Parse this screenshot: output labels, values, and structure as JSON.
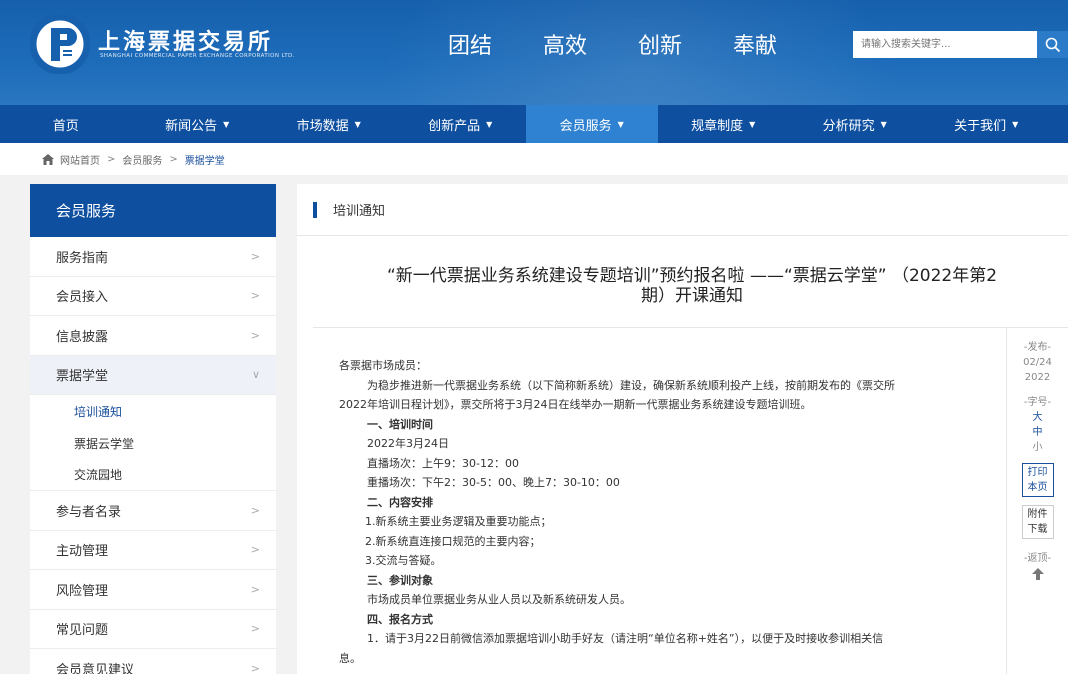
{
  "header": {
    "logo_text": "上海票据交易所",
    "logo_sub": "SHANGHAI COMMERCIAL PAPER EXCHANGE CORPORATION LTD.",
    "slogans": [
      "团结",
      "高效",
      "创新",
      "奉献"
    ],
    "search_placeholder": "请输入搜索关键字...",
    "colors": {
      "primary": "#0e4fa0",
      "accent": "#2f82d2"
    }
  },
  "nav": {
    "items": [
      {
        "label": "首页",
        "caret": ""
      },
      {
        "label": "新闻公告",
        "caret": "▼"
      },
      {
        "label": "市场数据",
        "caret": "▼"
      },
      {
        "label": "创新产品",
        "caret": "▼"
      },
      {
        "label": "会员服务",
        "caret": "▼"
      },
      {
        "label": "规章制度",
        "caret": "▼"
      },
      {
        "label": "分析研究",
        "caret": "▼"
      },
      {
        "label": "关于我们",
        "caret": "▼"
      }
    ],
    "active_index": 4
  },
  "breadcrumb": {
    "items": [
      "网站首页",
      "会员服务",
      "票据学堂"
    ],
    "separator": ">"
  },
  "sidebar": {
    "title": "会员服务",
    "items_top": [
      {
        "label": "服务指南",
        "arrow": ">"
      },
      {
        "label": "会员接入",
        "arrow": ">"
      },
      {
        "label": "信息披露",
        "arrow": ">"
      },
      {
        "label": "票据学堂",
        "arrow": "∨"
      }
    ],
    "subitems": [
      "培训通知",
      "票据云学堂",
      "交流园地"
    ],
    "items_bottom": [
      {
        "label": "参与者名录",
        "arrow": ">"
      },
      {
        "label": "主动管理",
        "arrow": ">"
      },
      {
        "label": "风险管理",
        "arrow": ">"
      },
      {
        "label": "常见问题",
        "arrow": ">"
      },
      {
        "label": "会员意见建议",
        "arrow": ">"
      }
    ]
  },
  "content": {
    "section_title": "培训通知",
    "article_title_1": "“新一代票据业务系统建设专题培训”预约报名啦 ——“票据云学堂” （2022年第2",
    "article_title_2": "期）开课通知",
    "body": {
      "greeting": "各票据市场成员：",
      "intro_1": "为稳步推进新一代票据业务系统（以下简称新系统）建设，确保新系统顺利投产上线，按前期发布的《票交所",
      "intro_2": "2022年培训日程计划》，票交所将于3月24日在线举办一期新一代票据业务系统建设专题培训班。",
      "h1": "一、培训时间",
      "date": "2022年3月24日",
      "live": "直播场次：上午9：30-12：00",
      "replay": "重播场次：下午2：30-5：00、晚上7：30-10：00",
      "h2": "二、内容安排",
      "c1": "1.新系统主要业务逻辑及重要功能点；",
      "c2": "2.新系统直连接口规范的主要内容；",
      "c3": "3.交流与答疑。",
      "h3": "三、参训对象",
      "audience": "市场成员单位票据业务从业人员以及新系统研发人员。",
      "h4": "四、报名方式",
      "signup_1": "1．请于3月22日前微信添加票据培训小助手好友（请注明“单位名称+姓名”），以便于及时接收参训相关信",
      "signup_2": "息。"
    }
  },
  "tools": {
    "publish_label": "-发布-",
    "publish_date_1": "02/24",
    "publish_date_2": "2022",
    "fontsize_label": "-字号-",
    "size_large": "大",
    "size_medium": "中",
    "size_small": "小",
    "print_1": "打印",
    "print_2": "本页",
    "attach_1": "附件",
    "attach_2": "下载",
    "back_label": "-返顶-"
  }
}
